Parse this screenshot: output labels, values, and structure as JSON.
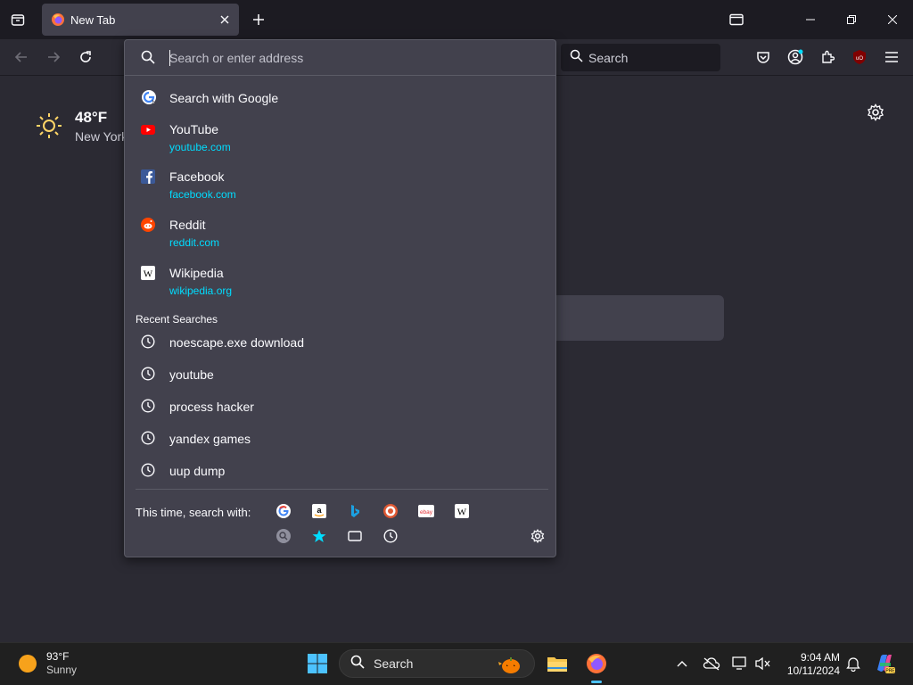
{
  "tab": {
    "title": "New Tab"
  },
  "toolbar": {
    "search_placeholder": "Search"
  },
  "weather": {
    "temp": "48°F",
    "location": "New York"
  },
  "urlbar": {
    "placeholder": "Search or enter address"
  },
  "suggestions": [
    {
      "label": "Search with Google",
      "url": "",
      "icon": "google-icon"
    },
    {
      "label": "YouTube",
      "url": "youtube.com",
      "icon": "youtube-icon"
    },
    {
      "label": "Facebook",
      "url": "facebook.com",
      "icon": "facebook-icon"
    },
    {
      "label": "Reddit",
      "url": "reddit.com",
      "icon": "reddit-icon"
    },
    {
      "label": "Wikipedia",
      "url": "wikipedia.org",
      "icon": "wikipedia-icon"
    }
  ],
  "recent": {
    "heading": "Recent Searches",
    "items": [
      "noescape.exe download",
      "youtube",
      "process hacker",
      "yandex games",
      "uup dump"
    ]
  },
  "engines": {
    "label": "This time, search with:",
    "list": [
      "google-icon",
      "amazon-icon",
      "bing-icon",
      "duckduckgo-icon",
      "ebay-icon",
      "wikipedia-icon"
    ],
    "modes": [
      "search-tabs-icon",
      "bookmarks-icon",
      "tabs-icon",
      "history-icon"
    ]
  },
  "taskbar": {
    "weather_temp": "93°F",
    "weather_desc": "Sunny",
    "search_label": "Search",
    "time": "9:04 AM",
    "date": "10/11/2024"
  },
  "colors": {
    "accent": "#00ddff",
    "panel": "#42414d",
    "background": "#2b2a33"
  }
}
